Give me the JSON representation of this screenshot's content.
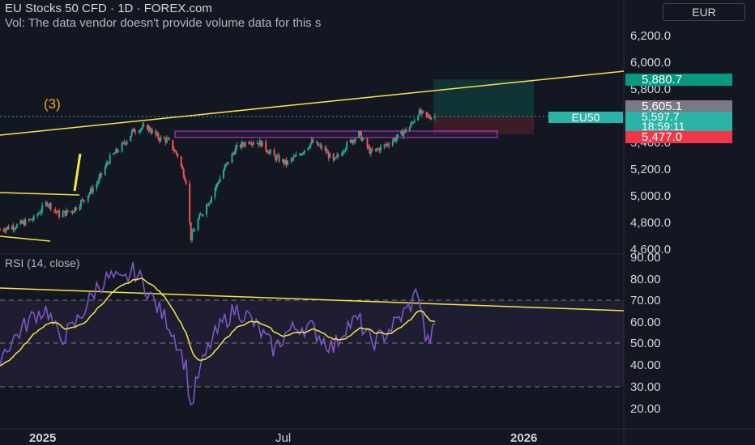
{
  "header": {
    "title": "EU Stocks 50 CFD · 1D · FOREX.com",
    "volume_note": "Vol: The data vendor doesn't provide volume data for this s",
    "currency": "EUR"
  },
  "rsi_label": "RSI (14, close)",
  "wave_label": "(3)",
  "symbol_tag": "EU50",
  "price_axis": {
    "ticks": [
      "6,200.0",
      "6,000.0",
      "5,800.0",
      "5,400.0",
      "5,200.0",
      "5,000.0",
      "4,800.0",
      "4,600.0"
    ]
  },
  "rsi_axis": {
    "ticks": [
      "90.00",
      "80.00",
      "70.00",
      "60.00",
      "50.00",
      "40.00",
      "30.00",
      "20.00"
    ]
  },
  "price_tags": {
    "target": "5,880.7",
    "high": "5,605.1",
    "last": "5,597.7",
    "countdown": "18:59:11",
    "stop": "5,477.0"
  },
  "time_axis": {
    "labels": [
      "2025",
      "Jul",
      "2026"
    ]
  },
  "colors": {
    "background": "#131722",
    "up": "#26a69a",
    "down": "#ef5350",
    "rsi_line": "#7e57c2",
    "rsi_ma": "#f7e44a",
    "trendline": "#f7e44a",
    "tag_teal": "#089981",
    "tag_grey": "#787b86",
    "tag_red": "#f23645"
  },
  "chart_data": [
    {
      "type": "candlestick",
      "title": "EU Stocks 50 CFD · 1D · FOREX.com",
      "currency": "EUR",
      "ylim": [
        4590,
        6300
      ],
      "x_range": [
        "2024-11",
        "2026-03"
      ],
      "close_points": [
        {
          "date": "2024-11-01",
          "close": 4760
        },
        {
          "date": "2024-11-15",
          "close": 4790
        },
        {
          "date": "2024-11-29",
          "close": 4840
        },
        {
          "date": "2024-12-10",
          "close": 4960
        },
        {
          "date": "2024-12-20",
          "close": 4870
        },
        {
          "date": "2024-12-31",
          "close": 4900
        },
        {
          "date": "2025-01-10",
          "close": 4990
        },
        {
          "date": "2025-01-20",
          "close": 5100
        },
        {
          "date": "2025-01-31",
          "close": 5290
        },
        {
          "date": "2025-02-10",
          "close": 5380
        },
        {
          "date": "2025-02-20",
          "close": 5500
        },
        {
          "date": "2025-03-03",
          "close": 5520
        },
        {
          "date": "2025-03-12",
          "close": 5440
        },
        {
          "date": "2025-03-20",
          "close": 5420
        },
        {
          "date": "2025-03-28",
          "close": 5310
        },
        {
          "date": "2025-04-04",
          "close": 5120
        },
        {
          "date": "2025-04-08",
          "close": 4700
        },
        {
          "date": "2025-04-14",
          "close": 4830
        },
        {
          "date": "2025-04-24",
          "close": 4990
        },
        {
          "date": "2025-05-05",
          "close": 5200
        },
        {
          "date": "2025-05-15",
          "close": 5360
        },
        {
          "date": "2025-05-26",
          "close": 5420
        },
        {
          "date": "2025-06-05",
          "close": 5400
        },
        {
          "date": "2025-06-16",
          "close": 5300
        },
        {
          "date": "2025-06-26",
          "close": 5250
        },
        {
          "date": "2025-07-07",
          "close": 5320
        },
        {
          "date": "2025-07-17",
          "close": 5410
        },
        {
          "date": "2025-07-28",
          "close": 5350
        },
        {
          "date": "2025-08-04",
          "close": 5260
        },
        {
          "date": "2025-08-14",
          "close": 5380
        },
        {
          "date": "2025-08-25",
          "close": 5470
        },
        {
          "date": "2025-09-04",
          "close": 5330
        },
        {
          "date": "2025-09-15",
          "close": 5380
        },
        {
          "date": "2025-09-25",
          "close": 5440
        },
        {
          "date": "2025-10-06",
          "close": 5520
        },
        {
          "date": "2025-10-13",
          "close": 5630
        },
        {
          "date": "2025-10-20",
          "close": 5600
        },
        {
          "date": "2025-10-27",
          "close": 5597.7
        }
      ],
      "last_price": 5597.7,
      "position": {
        "entry": 5605.1,
        "target": 5880.7,
        "stop": 5477.0
      },
      "support_zone": [
        5480,
        5520
      ]
    },
    {
      "type": "line",
      "title": "RSI (14, close)",
      "ylim": [
        15,
        92
      ],
      "levels": [
        70,
        50,
        30
      ],
      "series": [
        {
          "points": [
            {
              "date": "2024-11-01",
              "value": 44
            },
            {
              "date": "2024-11-15",
              "value": 54
            },
            {
              "date": "2024-11-29",
              "value": 63
            },
            {
              "date": "2024-12-10",
              "value": 66
            },
            {
              "date": "2024-12-20",
              "value": 52
            },
            {
              "date": "2024-12-31",
              "value": 57
            },
            {
              "date": "2025-01-10",
              "value": 66
            },
            {
              "date": "2025-01-20",
              "value": 76
            },
            {
              "date": "2025-01-31",
              "value": 81
            },
            {
              "date": "2025-02-10",
              "value": 78
            },
            {
              "date": "2025-02-20",
              "value": 84
            },
            {
              "date": "2025-03-03",
              "value": 75
            },
            {
              "date": "2025-03-12",
              "value": 66
            },
            {
              "date": "2025-03-20",
              "value": 60
            },
            {
              "date": "2025-03-28",
              "value": 50
            },
            {
              "date": "2025-04-04",
              "value": 39
            },
            {
              "date": "2025-04-08",
              "value": 20
            },
            {
              "date": "2025-04-14",
              "value": 35
            },
            {
              "date": "2025-04-24",
              "value": 50
            },
            {
              "date": "2025-05-05",
              "value": 60
            },
            {
              "date": "2025-05-15",
              "value": 66
            },
            {
              "date": "2025-05-26",
              "value": 62
            },
            {
              "date": "2025-06-05",
              "value": 55
            },
            {
              "date": "2025-06-16",
              "value": 47
            },
            {
              "date": "2025-06-26",
              "value": 55
            },
            {
              "date": "2025-07-07",
              "value": 58
            },
            {
              "date": "2025-07-17",
              "value": 57
            },
            {
              "date": "2025-07-28",
              "value": 51
            },
            {
              "date": "2025-08-04",
              "value": 48
            },
            {
              "date": "2025-08-14",
              "value": 58
            },
            {
              "date": "2025-08-25",
              "value": 61
            },
            {
              "date": "2025-09-04",
              "value": 50
            },
            {
              "date": "2025-09-15",
              "value": 54
            },
            {
              "date": "2025-09-25",
              "value": 60
            },
            {
              "date": "2025-10-06",
              "value": 67
            },
            {
              "date": "2025-10-13",
              "value": 75
            },
            {
              "date": "2025-10-20",
              "value": 49
            },
            {
              "date": "2025-10-27",
              "value": 57
            }
          ]
        }
      ]
    }
  ]
}
